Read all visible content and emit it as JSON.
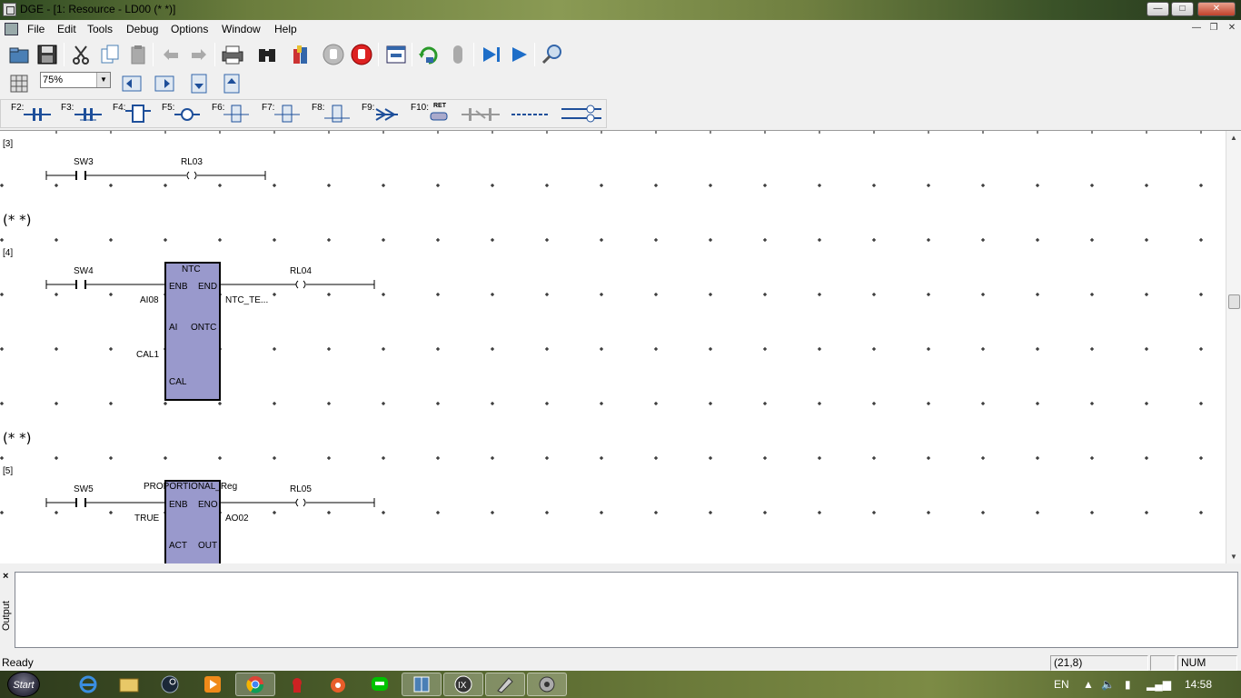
{
  "window": {
    "title": "DGE - [1: Resource - LD00 (*  *)]",
    "minimize_label": "—",
    "maximize_label": "□",
    "close_label": "✕"
  },
  "menu": {
    "items": [
      "File",
      "Edit",
      "Tools",
      "Debug",
      "Options",
      "Window",
      "Help"
    ],
    "mdi_minimize": "—",
    "mdi_restore": "❐",
    "mdi_close": "✕"
  },
  "toolbar1": {
    "icons": [
      "open-folder-icon",
      "save-icon",
      "cut-icon",
      "copy-icon",
      "paste-icon",
      "undo-icon",
      "redo-icon",
      "print-icon",
      "find-icon",
      "library-icon",
      "stop-hand-icon",
      "stop-red-icon",
      "window-icon",
      "refresh-icon",
      "disabled-icon",
      "step-icon",
      "run-icon",
      "zoom-search-icon"
    ]
  },
  "toolbar2": {
    "zoom_value": "75%",
    "zoom_arrow": "▼"
  },
  "fkeys": {
    "labels": [
      "F2:",
      "F3:",
      "F4:",
      "F5:",
      "F6:",
      "F7:",
      "F8:",
      "F9:",
      "F10:"
    ],
    "ret_label": "RET"
  },
  "diagram": {
    "rungs": [
      {
        "number": "[3]",
        "contact": "SW3",
        "coil": "RL03"
      },
      {
        "comment": "(*  *)"
      },
      {
        "number": "[4]",
        "contact": "SW4",
        "coil": "RL04",
        "block": {
          "type": "NTC",
          "inputs": [
            "ENB",
            "AI",
            "CAL"
          ],
          "outputs": [
            "END",
            "ONTC"
          ],
          "in_vars": [
            "AI08",
            "CAL1"
          ],
          "out_var": "NTC_TE..."
        }
      },
      {
        "comment": "(*  *)"
      },
      {
        "number": "[5]",
        "contact": "SW5",
        "coil": "RL05",
        "block": {
          "type": "PROPORTIONAL_Reg",
          "inputs": [
            "ENB",
            "ACT"
          ],
          "outputs": [
            "ENO",
            "OUT"
          ],
          "in_vars": [
            "TRUE"
          ],
          "out_var": "AO02"
        }
      }
    ]
  },
  "output_pane": {
    "close_label": "×",
    "tab_label": "Output"
  },
  "status": {
    "text": "Ready",
    "position": "(21,8)",
    "num": "NUM"
  },
  "taskbar": {
    "start_label": "Start",
    "apps": [
      "ie-icon",
      "explorer-icon",
      "steam-icon",
      "media-player-icon",
      "chrome-icon",
      "game-icon",
      "app-icon",
      "line-icon",
      "network-icon",
      "ix-icon",
      "dge-icon",
      "dge2-icon"
    ],
    "language": "EN",
    "clock": "14:58"
  }
}
